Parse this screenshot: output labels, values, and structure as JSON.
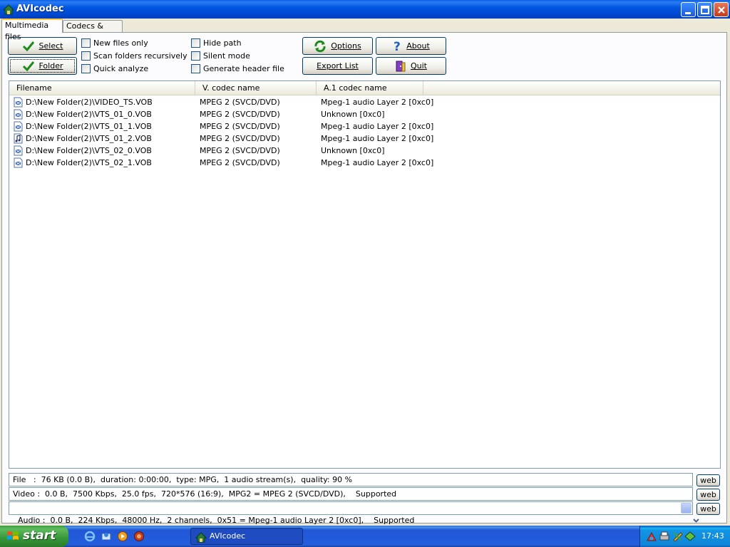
{
  "window": {
    "title": "AVIcodec"
  },
  "tabs": [
    {
      "label": "Multimedia files",
      "active": true
    },
    {
      "label": "Codecs & Filters",
      "active": false
    }
  ],
  "toolbar": {
    "select_label": "Select",
    "folder_label": "Folder",
    "options_label": "Options",
    "about_label": "About",
    "export_label": "Export List",
    "quit_label": "Quit"
  },
  "checkboxes": {
    "new_files_only": "New files only",
    "scan_recursive": "Scan folders recursively",
    "quick_analyze": "Quick analyze",
    "hide_path": "Hide path",
    "silent_mode": "Silent mode",
    "generate_header": "Generate header file"
  },
  "list": {
    "columns": [
      "Filename",
      "V. codec name",
      "A.1 codec name"
    ],
    "rows": [
      {
        "filename": "D:\\New Folder(2)\\VIDEO_TS.VOB",
        "vcodec": "MPEG 2 (SVCD/DVD)",
        "acodec": "Mpeg-1 audio Layer 2 [0xc0]",
        "icon": "video-file-icon"
      },
      {
        "filename": "D:\\New Folder(2)\\VTS_01_0.VOB",
        "vcodec": "MPEG 2 (SVCD/DVD)",
        "acodec": "Unknown [0xc0]",
        "icon": "video-file-icon"
      },
      {
        "filename": "D:\\New Folder(2)\\VTS_01_1.VOB",
        "vcodec": "MPEG 2 (SVCD/DVD)",
        "acodec": "Mpeg-1 audio Layer 2 [0xc0]",
        "icon": "video-file-icon"
      },
      {
        "filename": "D:\\New Folder(2)\\VTS_01_2.VOB",
        "vcodec": "MPEG 2 (SVCD/DVD)",
        "acodec": "Mpeg-1 audio Layer 2 [0xc0]",
        "icon": "audio-file-icon"
      },
      {
        "filename": "D:\\New Folder(2)\\VTS_02_0.VOB",
        "vcodec": "MPEG 2 (SVCD/DVD)",
        "acodec": "Unknown [0xc0]",
        "icon": "video-file-icon"
      },
      {
        "filename": "D:\\New Folder(2)\\VTS_02_1.VOB",
        "vcodec": "MPEG 2 (SVCD/DVD)",
        "acodec": "Mpeg-1 audio Layer 2 [0xc0]",
        "icon": "video-file-icon"
      }
    ]
  },
  "info": {
    "file": "File   :  76 KB (0.0 B),  duration: 0:00:00,  type: MPG,  1 audio stream(s),  quality: 90 %",
    "video": "Video :  0.0 B,  7500 Kbps,  25.0 fps,  720*576 (16:9),  MPG2 = MPEG 2 (SVCD/DVD),    Supported",
    "audio": "Audio :  0.0 B,  224 Kbps,  48000 Hz,  2 channels,  0x51 = Mpeg-1 audio Layer 2 [0xc0],    Supported",
    "web_label": "web"
  },
  "taskbar": {
    "start_label": "start",
    "task_label": "AVIcodec",
    "clock": "17:43"
  },
  "colors": {
    "titlebar": "#0054E3",
    "accent_check": "#1E8A1E",
    "tab_highlight": "#FFC83C"
  }
}
